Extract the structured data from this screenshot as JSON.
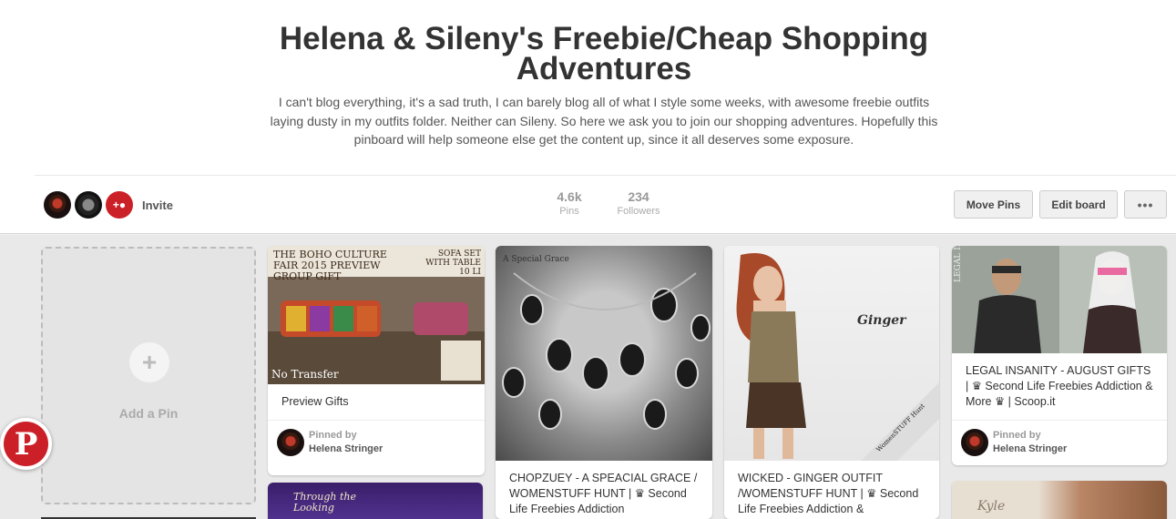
{
  "board": {
    "title": "Helena & Sileny's Freebie/Cheap Shopping Adventures",
    "description": "I can't blog everything, it's a sad truth, I can barely blog all of what I style some weeks, with awesome freebie outfits laying dusty in my outfits folder. Neither can Sileny. So here we ask you to join our shopping adventures. Hopefully this pinboard will help someone else get the content up, since it all deserves some exposure."
  },
  "toolbar": {
    "invite_label": "Invite",
    "stats": [
      {
        "value": "4.6k",
        "label": "Pins"
      },
      {
        "value": "234",
        "label": "Followers"
      }
    ],
    "move_pins_label": "Move Pins",
    "edit_board_label": "Edit board",
    "more_label": "•••"
  },
  "add_pin": {
    "label": "Add a Pin",
    "icon": "plus-icon"
  },
  "pins": [
    {
      "image_caption_top": "THE BOHO CULTURE FAIR 2015 PREVIEW GROUP GIFT",
      "image_caption_bottom": "No Transfer",
      "image_caption_right": "SOFA SET WITH TABLE 10 LI",
      "description": "Preview Gifts",
      "pinned_by_label": "Pinned by",
      "pinned_by_name": "Helena Stringer"
    },
    {
      "image_caption_top": "A Special Grace",
      "description": "CHOPZUEY - A SPEACIAL GRACE / WOMENSTUFF HUNT | ♛ Second Life Freebies Addiction"
    },
    {
      "image_caption_top": "Ginger",
      "image_caption_ribbon": "WomenSTUFF Hunt",
      "description": "WICKED - GINGER OUTFIT /WOMENSTUFF HUNT | ♛ Second Life Freebies Addiction &"
    },
    {
      "image_caption_top": "LEGAL INSANITY",
      "description": "LEGAL INSANITY - AUGUST GIFTS | ♛ Second Life Freebies Addiction & More ♛ | Scoop.it",
      "pinned_by_label": "Pinned by",
      "pinned_by_name": "Helena Stringer"
    },
    {
      "image_caption_top": "Through the Looking"
    },
    {
      "image_caption_top": "Kyle"
    }
  ],
  "pinterest_button": {
    "glyph": "P"
  },
  "colors": {
    "brand_red": "#cb2027",
    "background": "#e9e9e9"
  }
}
